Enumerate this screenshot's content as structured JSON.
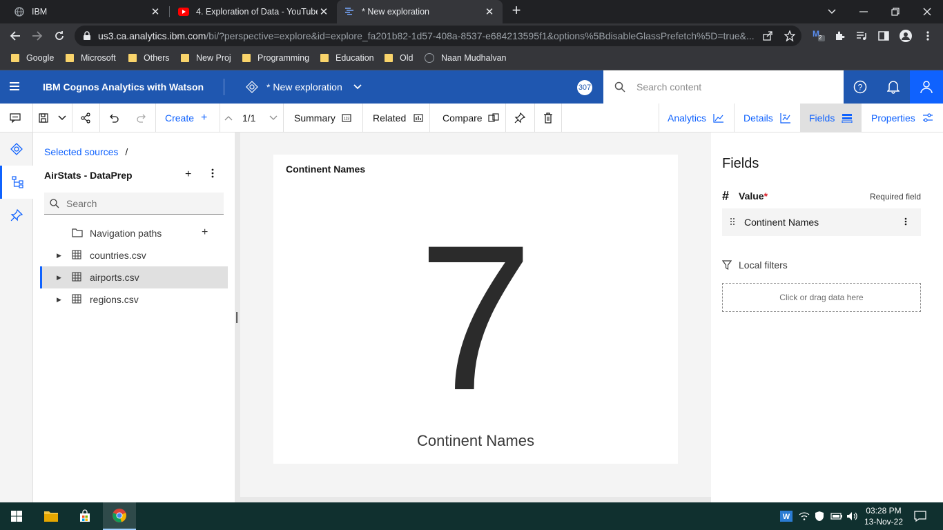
{
  "browser": {
    "tabs": [
      {
        "title": "IBM",
        "favicon": "globe-icon",
        "active": false
      },
      {
        "title": "4. Exploration of Data - YouTube",
        "favicon": "youtube-icon",
        "active": false
      },
      {
        "title": "* New exploration",
        "favicon": "cognos-icon",
        "active": true
      }
    ],
    "url_host": "us3.ca.analytics.ibm.com",
    "url_path": "/bi/?perspective=explore&id=explore_fa201b82-1d57-408a-8537-e684213595f1&options%5BdisableGlassPrefetch%5D=true&...",
    "extension_badge": "2",
    "bookmarks": [
      "Google",
      "Microsoft",
      "Others",
      "New Proj",
      "Programming",
      "Education",
      "Old",
      "Naan Mudhalvan"
    ]
  },
  "header": {
    "brand": "IBM Cognos Analytics with Watson",
    "exploration_title": "* New exploration",
    "notification_count": "307",
    "search_placeholder": "Search content"
  },
  "toolbar": {
    "create_label": "Create",
    "page_indicator": "1/1",
    "summary_label": "Summary",
    "related_label": "Related",
    "compare_label": "Compare",
    "analytics_label": "Analytics",
    "details_label": "Details",
    "fields_label": "Fields",
    "properties_label": "Properties"
  },
  "sources": {
    "breadcrumb": "Selected sources",
    "breadcrumb_sep": "/",
    "title": "AirStats - DataPrep",
    "search_placeholder": "Search",
    "tree": [
      {
        "label": "Navigation paths",
        "type": "folder",
        "selected": false
      },
      {
        "label": "countries.csv",
        "type": "table",
        "selected": false
      },
      {
        "label": "airports.csv",
        "type": "table",
        "selected": true
      },
      {
        "label": "regions.csv",
        "type": "table",
        "selected": false
      }
    ]
  },
  "card": {
    "title": "Continent Names",
    "kpi_value": "7",
    "kpi_label": "Continent Names"
  },
  "fields": {
    "title": "Fields",
    "slot_icon": "#",
    "slot_label": "Value",
    "slot_required_mark": "*",
    "required_text": "Required field",
    "slot_item": "Continent Names",
    "filters_label": "Local filters",
    "dropzone_text": "Click or drag data here"
  },
  "taskbar": {
    "time": "03:28 PM",
    "date": "13-Nov-22"
  },
  "colors": {
    "ibm_header": "#1f57b0",
    "accent": "#0f62fe",
    "chrome_dark": "#202124"
  }
}
